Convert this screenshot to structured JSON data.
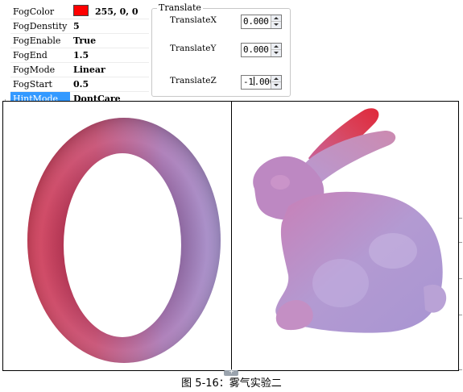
{
  "properties": [
    {
      "name": "FogColor",
      "value": "255,  0,  0",
      "swatch": "#ff0000"
    },
    {
      "name": "FogDenstity",
      "value": "5"
    },
    {
      "name": "FogEnable",
      "value": "True"
    },
    {
      "name": "FogEnd",
      "value": "1.5"
    },
    {
      "name": "FogMode",
      "value": "Linear"
    },
    {
      "name": "FogStart",
      "value": "0.5"
    },
    {
      "name": "HintMode",
      "value": "DontCare",
      "selected": true
    }
  ],
  "translate": {
    "title": "Translate",
    "x": {
      "label": "TranslateX",
      "value": "0.000"
    },
    "y": {
      "label": "TranslateY",
      "value": "0.000"
    },
    "z": {
      "label": "TranslateZ",
      "value_before_caret": "-1",
      "value_after_caret": ".000"
    }
  },
  "caption": "图 5-16：雾气实验二",
  "colors": {
    "selection": "#3399ff",
    "fog_red": "#d03048",
    "base_purple": "#9a82c6"
  }
}
